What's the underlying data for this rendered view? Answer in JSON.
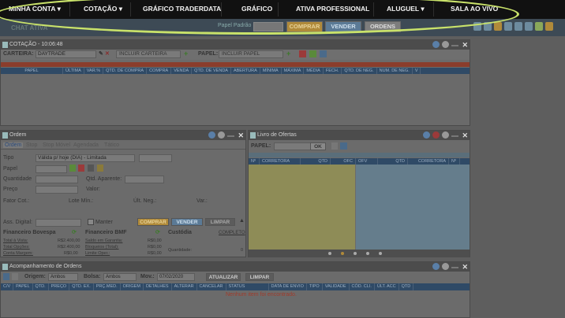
{
  "nav": {
    "items": [
      {
        "label": "MINHA CONTA",
        "caret": "▾"
      },
      {
        "label": "COTAÇÃO",
        "caret": "▾"
      },
      {
        "label": "GRÁFICO TRADERDATA",
        "caret": ""
      },
      {
        "label": "GRÁFICO",
        "caret": ""
      },
      {
        "label": "ATIVA PROFESSIONAL",
        "caret": ""
      },
      {
        "label": "ALUGUEL",
        "caret": "▾"
      },
      {
        "label": "SALA AO VIVO",
        "caret": ""
      }
    ]
  },
  "subbar": {
    "papel_label": "Papel Padrão",
    "comprar": "COMPRAR",
    "vender": "VENDER",
    "ordens": "ORDENS",
    "chat_tab": "CHAT ATIVA"
  },
  "cotacao": {
    "title": "COTAÇÃO - 10:06:48",
    "carteira_label": "CARTEIRA:",
    "carteira_value": "DAYTRADE",
    "incluir_carteira": "INCLUIR CARTEIRA",
    "papel_label": "PAPEL:",
    "incluir_papel": "INCLUIR PAPEL",
    "columns": [
      "PAPEL",
      "ÚLTIMA",
      "VAR.%",
      "QTD. DE COMPRA",
      "COMPRA",
      "VENDA",
      "QTD. DE VENDA",
      "ABERTURA",
      "MÍNIMA",
      "MÁXIMA",
      "MÉDIA",
      "FECH.",
      "QTD. DE NEG.",
      "NUM. DE NEG.",
      "V"
    ]
  },
  "ordem": {
    "title": "Ordem",
    "tabs": [
      "Ordem",
      "Stop",
      "Stop Móvel",
      "Agendada",
      "Tático"
    ],
    "tipo_label": "Tipo",
    "tipo_value": "Válida p/ hoje (DIA) - Limitada",
    "papel_label": "Papel",
    "quantidade_label": "Quantidade",
    "qtd_aparente_label": "Qtd. Aparente:",
    "preco_label": "Preço",
    "valor_label": "Valor:",
    "fator_label": "Fator Cot.:",
    "lote_label": "Lote Mín.:",
    "ult_neg_label": "Últ. Neg.:",
    "var_label": "Var.:",
    "ass_digital_label": "Ass. Digital:",
    "manter_label": "Manter",
    "comprar": "COMPRAR",
    "vender": "VENDER",
    "limpar": "LIMPAR",
    "fin_bovespa": {
      "title": "Financeiro Bovespa",
      "rows": [
        {
          "k": "Total à Vista:",
          "v": "R$2.400,00"
        },
        {
          "k": "Total Opções:",
          "v": "R$2.400,00"
        },
        {
          "k": "Conta Margem:",
          "v": "R$0,00"
        }
      ]
    },
    "fin_bmf": {
      "title": "Financeiro BMF",
      "rows": [
        {
          "k": "Saldo em Garantia:",
          "v": "R$0,00"
        },
        {
          "k": "Bloqueios (Total):",
          "v": "R$0,00"
        },
        {
          "k": "Limite Oper.:",
          "v": "R$0,00"
        }
      ]
    },
    "custodia": {
      "title": "Custódia",
      "completo": "COMPLETO",
      "quantidade_label": "Quantidade:",
      "quantidade_value": "0"
    }
  },
  "livro": {
    "title": "Livro de Ofertas",
    "papel_label": "PAPEL:",
    "ok": "OK",
    "columns_left": [
      "Nº",
      "CORRETORA",
      "QTD",
      "OFC"
    ],
    "columns_right": [
      "OFV",
      "QTD",
      "CORRETORA",
      "Nº"
    ]
  },
  "acomp": {
    "title": "Acompanhamento de Ordens",
    "origem_label": "Origem:",
    "origem_value": "Ambos",
    "bolsa_label": "Bolsa:",
    "bolsa_value": "Ambos",
    "mov_label": "Mov.:",
    "mov_value": "07/02/2020",
    "atualizar": "ATUALIZAR",
    "limpar": "LIMPAR",
    "columns": [
      "C/V",
      "PAPEL",
      "QTD.",
      "PREÇO",
      "QTD. EX.",
      "PRÇ.MED.",
      "ORIGEM",
      "DETALHES",
      "ALTERAR",
      "CANCELAR",
      "STATUS",
      "DATA DE ENVIO",
      "TIPO",
      "VALIDADE",
      "CÓD. CLI.",
      "ÚLT. ACC",
      "QTD"
    ],
    "empty": "Nenhum item foi encontrado."
  },
  "colors": {
    "accent_ring": "#c9e26a",
    "comprar": "#d9a441",
    "vender": "#7da4c7",
    "livro_left": "#8e8c57",
    "livro_right": "#657d8c",
    "empty_text": "#a03a2a"
  }
}
